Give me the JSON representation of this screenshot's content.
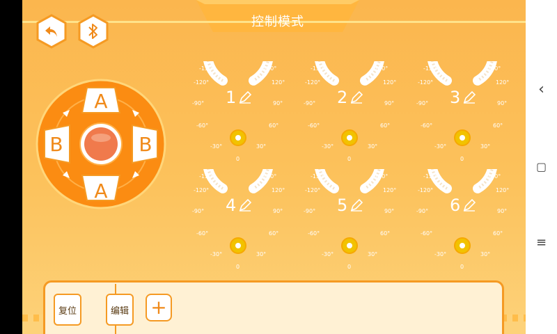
{
  "header": {
    "title": "控制模式"
  },
  "toolbar": {
    "back_icon": "back-arrow-icon",
    "bluetooth_icon": "bluetooth-icon"
  },
  "joystick": {
    "top_label": "A",
    "bottom_label": "A",
    "left_label": "B",
    "right_label": "B",
    "center_color": "#f07a4c"
  },
  "tick_labels": {
    "m150": "-150°",
    "m120": "-120°",
    "m90": "-90°",
    "m60": "-60°",
    "m30": "-30°",
    "zero": "0",
    "p30": "30°",
    "p60": "60°",
    "p90": "90°",
    "p120": "120°",
    "p150": "150°"
  },
  "servos": [
    {
      "number": "1",
      "angle": 0
    },
    {
      "number": "2",
      "angle": 0
    },
    {
      "number": "3",
      "angle": 0
    },
    {
      "number": "4",
      "angle": 0
    },
    {
      "number": "5",
      "angle": 0
    },
    {
      "number": "6",
      "angle": 0
    }
  ],
  "bottom_panel": {
    "reset_label": "复位",
    "edit_label": "编辑",
    "add_label": "+"
  },
  "navigation": {
    "back": "‹",
    "home": "▢",
    "menu": "≡"
  },
  "colors": {
    "accent": "#f59a23",
    "knob": "#f2c200",
    "background": "#fbb64e"
  }
}
